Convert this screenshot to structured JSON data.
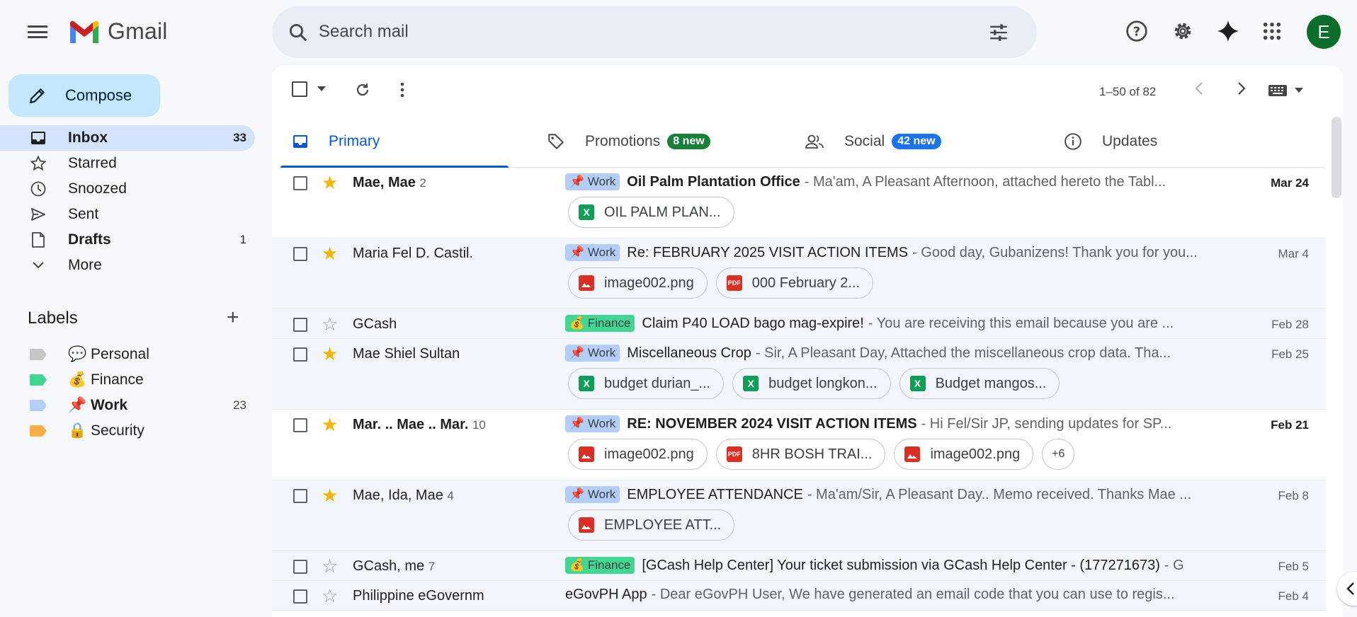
{
  "app": {
    "logo_text": "Gmail"
  },
  "search": {
    "placeholder": "Search mail"
  },
  "account": {
    "initial": "E",
    "color": "#0b6e2b"
  },
  "sidebar": {
    "compose_label": "Compose",
    "items": [
      {
        "label": "Inbox",
        "count": "33",
        "icon": "inbox-icon"
      },
      {
        "label": "Starred",
        "count": "",
        "icon": "star-icon"
      },
      {
        "label": "Snoozed",
        "count": "",
        "icon": "clock-icon"
      },
      {
        "label": "Sent",
        "count": "",
        "icon": "send-icon"
      },
      {
        "label": "Drafts",
        "count": "1",
        "icon": "draft-icon"
      },
      {
        "label": "More",
        "count": "",
        "icon": "chevron-down-icon"
      }
    ],
    "labels_heading": "Labels",
    "labels": [
      {
        "label": "💬 Personal",
        "count": "",
        "color": "#c4c7c5"
      },
      {
        "label": "💰 Finance",
        "count": "",
        "color": "#42d692"
      },
      {
        "label": "📌 Work",
        "count": "23",
        "color": "#b3cefb"
      },
      {
        "label": "🔒 Security",
        "count": "",
        "color": "#ffad47"
      }
    ]
  },
  "toolbar": {
    "pager_text": "1–50 of 82"
  },
  "tabs": [
    {
      "label": "Primary",
      "badge": ""
    },
    {
      "label": "Promotions",
      "badge": "8 new",
      "badge_color": "#188038"
    },
    {
      "label": "Social",
      "badge": "42 new",
      "badge_color": "#1a73e8"
    },
    {
      "label": "Updates",
      "badge": ""
    }
  ],
  "emails": [
    {
      "sender": "Mae, Mae",
      "count": "2",
      "starred": true,
      "unread": true,
      "label": "📌 Work",
      "label_type": "work",
      "subject": "Oil Palm Plantation Office",
      "snippet": "- Ma'am, A Pleasant Afternoon, attached hereto the Tabl...",
      "date": "Mar 24",
      "attachments": [
        {
          "name": "OIL PALM PLAN...",
          "type": "x"
        }
      ]
    },
    {
      "sender": "Maria Fel D. Castil.",
      "count": "",
      "starred": true,
      "unread": false,
      "label": "📌 Work",
      "label_type": "work",
      "subject": "Re: FEBRUARY 2025 VISIT ACTION ITEMS",
      "snippet": "- Good day, Gubanizens! Thank you for you...",
      "date": "Mar 4",
      "attachments": [
        {
          "name": "image002.png",
          "type": "img"
        },
        {
          "name": "000 February 2...",
          "type": "pdf"
        }
      ]
    },
    {
      "sender": "GCash",
      "count": "",
      "starred": false,
      "unread": false,
      "label": "💰 Finance",
      "label_type": "fin",
      "subject": "Claim P40 LOAD bago mag-expire!",
      "snippet": "- You are receiving this email because you are ...",
      "date": "Feb 28",
      "attachments": []
    },
    {
      "sender": "Mae Shiel Sultan",
      "count": "",
      "starred": true,
      "unread": false,
      "label": "📌 Work",
      "label_type": "work",
      "subject": "Miscellaneous Crop",
      "snippet": "- Sir, A Pleasant Day, Attached the miscellaneous crop data. Tha...",
      "date": "Feb 25",
      "attachments": [
        {
          "name": "budget durian_...",
          "type": "x"
        },
        {
          "name": "budget longkon...",
          "type": "x"
        },
        {
          "name": "Budget mangos...",
          "type": "x"
        }
      ]
    },
    {
      "sender": "Mar. .. Mae .. Mar.",
      "count": "10",
      "starred": true,
      "unread": true,
      "label": "📌 Work",
      "label_type": "work",
      "subject": "RE: NOVEMBER 2024 VISIT ACTION ITEMS",
      "snippet": "- Hi Fel/Sir JP, sending updates for SP...",
      "date": "Feb 21",
      "attachments": [
        {
          "name": "image002.png",
          "type": "img"
        },
        {
          "name": "8HR BOSH TRAI...",
          "type": "pdf"
        },
        {
          "name": "image002.png",
          "type": "img"
        }
      ],
      "more": "+6"
    },
    {
      "sender": "Mae, Ida, Mae",
      "count": "4",
      "starred": true,
      "unread": false,
      "label": "📌 Work",
      "label_type": "work",
      "subject": "EMPLOYEE ATTENDANCE",
      "snippet": "- Ma'am/Sir, A Pleasant Day.. Memo received. Thanks Mae ...",
      "date": "Feb 8",
      "attachments": [
        {
          "name": "EMPLOYEE ATT...",
          "type": "img"
        }
      ]
    },
    {
      "sender": "GCash, me",
      "count": "7",
      "starred": false,
      "unread": false,
      "label": "💰 Finance",
      "label_type": "fin",
      "subject": "[GCash Help Center] Your ticket submission via GCash Help Center - (177271673)",
      "snippet": "- G",
      "date": "Feb 5",
      "attachments": []
    },
    {
      "sender": "Philippine eGovernm",
      "count": "",
      "starred": false,
      "unread": false,
      "label": "",
      "label_type": "",
      "subject": "eGovPH App",
      "snippet": "- Dear eGovPH User, We have generated an email code that you can use to regis...",
      "date": "Feb 4",
      "attachments": []
    }
  ]
}
